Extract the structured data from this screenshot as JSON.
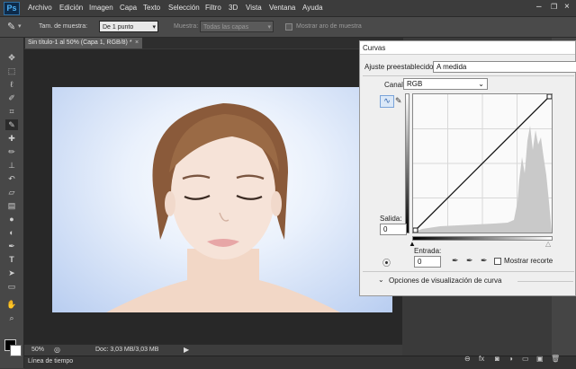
{
  "app": {
    "logo": "Ps"
  },
  "menu": [
    "Archivo",
    "Edición",
    "Imagen",
    "Capa",
    "Texto",
    "Selección",
    "Filtro",
    "3D",
    "Vista",
    "Ventana",
    "Ayuda"
  ],
  "options": {
    "sample_size_label": "Tam. de muestra:",
    "sample_size_value": "De 1 punto",
    "sample_label": "Muestra:",
    "sample_value": "Todas las capas",
    "show_ring_label": "Mostrar aro de muestra"
  },
  "document": {
    "tab_title": "Sin título-1 al 50% (Capa 1, RGB/8) *",
    "close": "×",
    "zoom": "50%",
    "doc_info": "Doc: 3,03 MB/3,03 MB"
  },
  "timeline": {
    "label": "Línea de tiempo"
  },
  "curves": {
    "title": "Curvas",
    "preset_label": "Ajuste preestablecido:",
    "preset_value": "A medida",
    "channel_label": "Canal:",
    "channel_value": "RGB",
    "output_label": "Salida:",
    "output_value": "0",
    "input_label": "Entrada:",
    "input_value": "0",
    "show_clipping_label": "Mostrar recorte",
    "display_options_label": "Opciones de visualización de curva"
  },
  "tools": [
    "move-icon",
    "marquee-icon",
    "lasso-icon",
    "quick-select-icon",
    "crop-icon",
    "eyedropper-icon",
    "healing-icon",
    "brush-icon",
    "stamp-icon",
    "history-brush-icon",
    "eraser-icon",
    "gradient-icon",
    "blur-icon",
    "dodge-icon",
    "pen-icon",
    "type-icon",
    "path-select-icon",
    "shape-icon",
    "hand-icon",
    "zoom-icon"
  ],
  "colors": {
    "ui_dark": "#3a3a3a",
    "dialog_bg": "#efefef",
    "accent": "#4fb3f7"
  }
}
